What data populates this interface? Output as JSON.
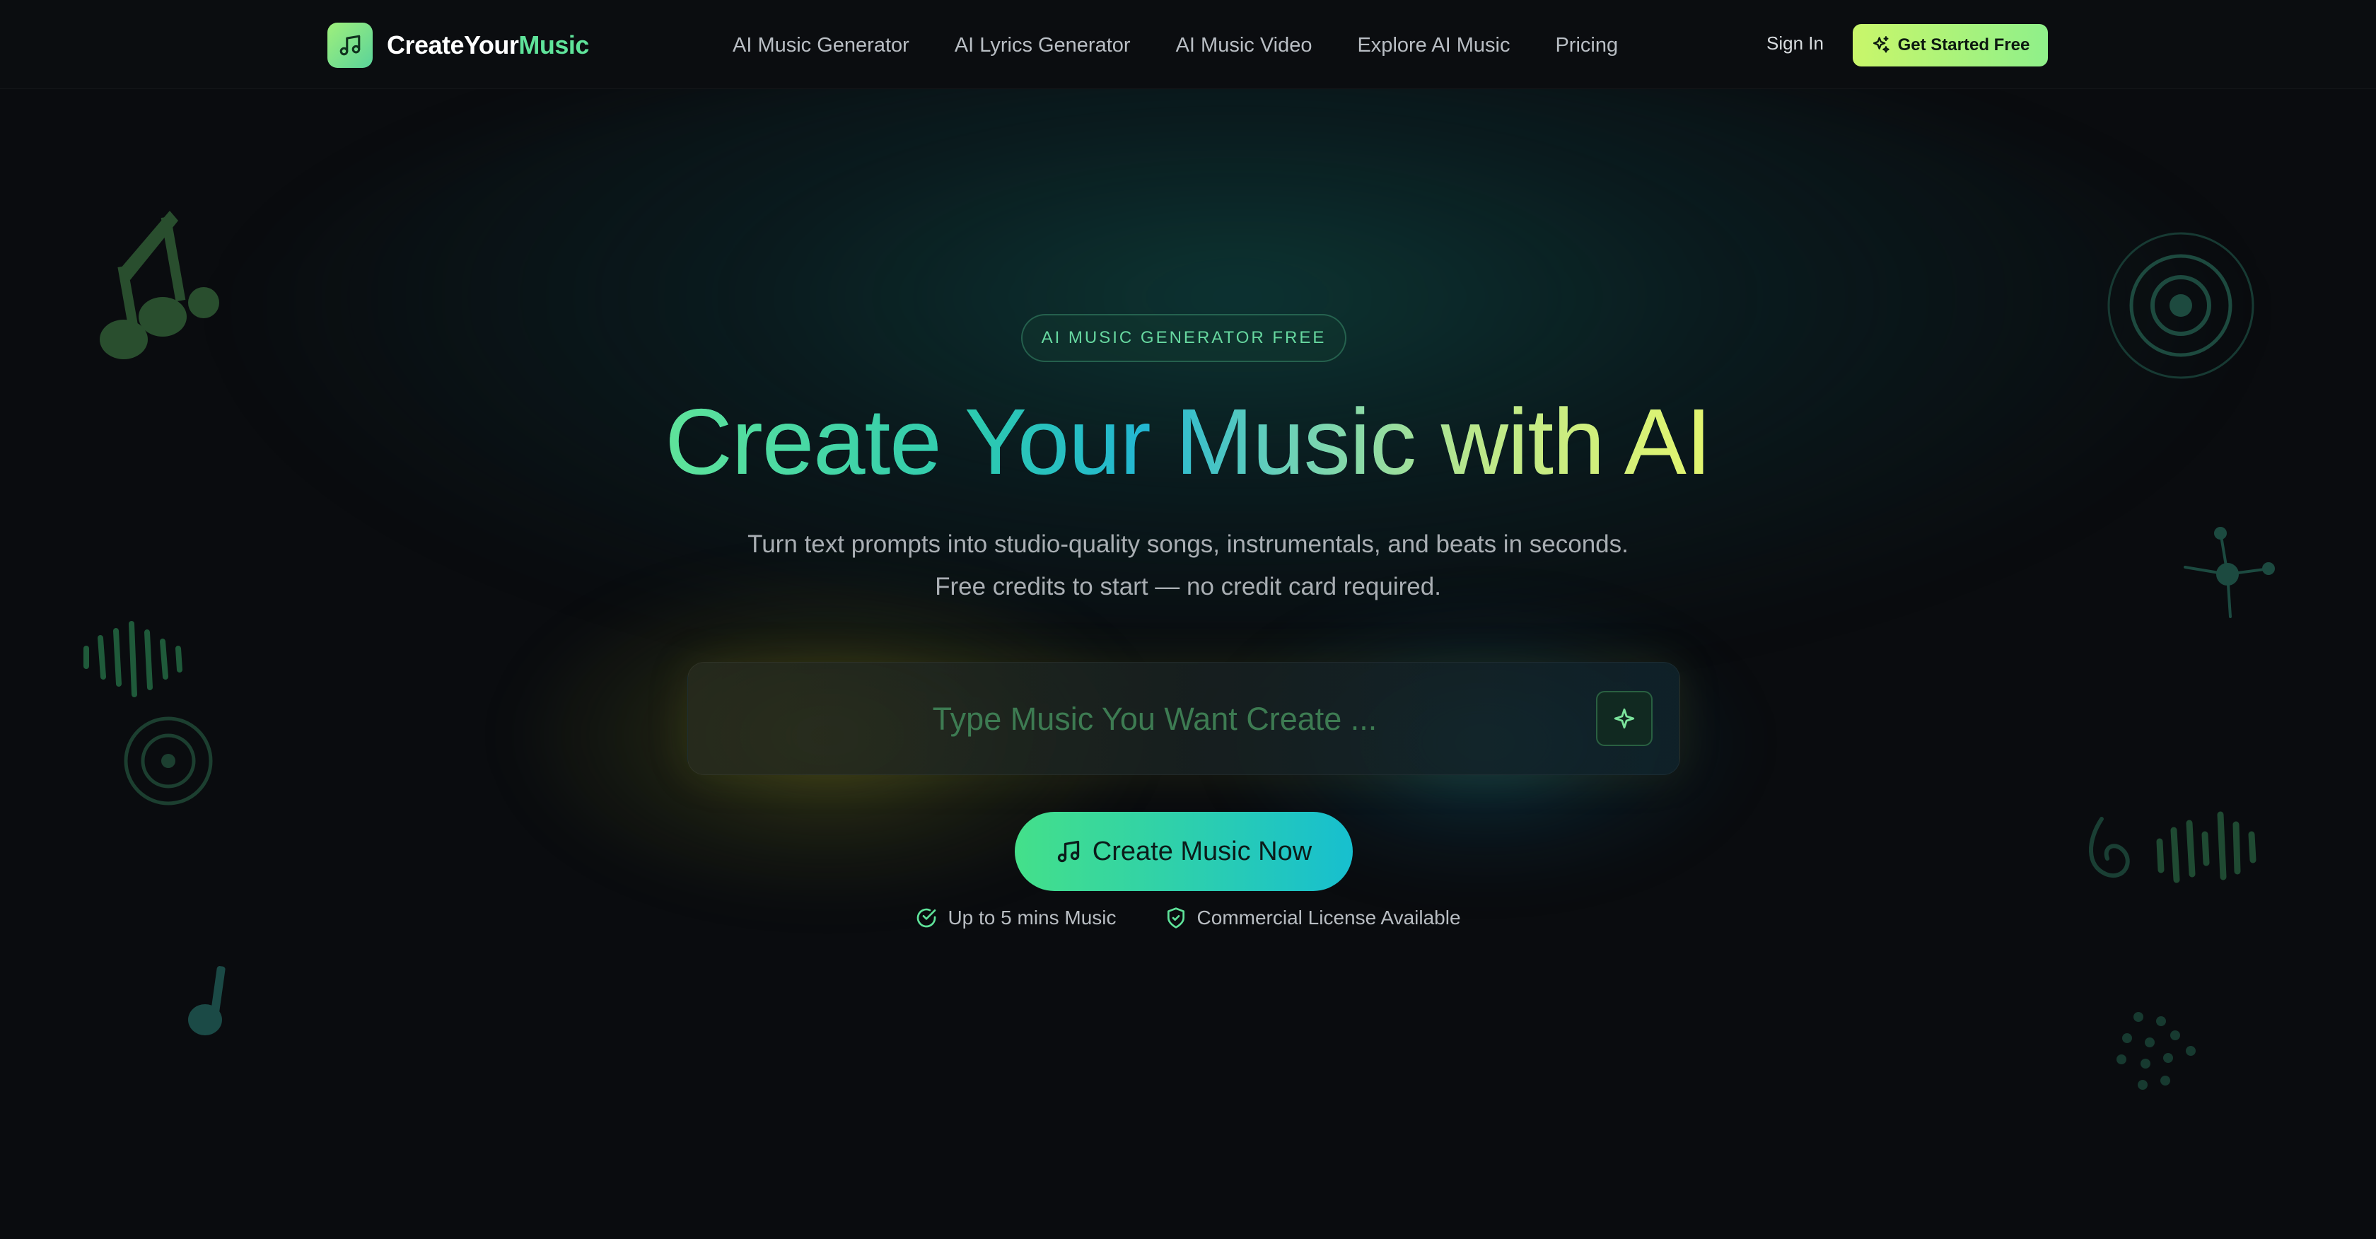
{
  "header": {
    "logo_word_1": "CreateYour",
    "logo_word_2": "Music",
    "nav": [
      "AI Music Generator",
      "AI Lyrics Generator",
      "AI Music Video",
      "Explore AI Music",
      "Pricing"
    ],
    "sign_in": "Sign In",
    "cta": "Get Started Free"
  },
  "hero": {
    "badge": "AI MUSIC GENERATOR FREE",
    "headline": "Create Your Music with AI",
    "subtitle_line_1": "Turn text prompts into studio-quality songs, instrumentals, and beats in seconds.",
    "subtitle_line_2": "Free credits to start — no credit card required.",
    "prompt": {
      "placeholder": "Type Music You Want Create ...",
      "value": ""
    },
    "create_button": "Create Music Now",
    "features": [
      {
        "icon": "check-circle-icon",
        "label": "Up to 5 mins Music"
      },
      {
        "icon": "shield-check-icon",
        "label": "Commercial License Available"
      }
    ]
  },
  "colors": {
    "accent_green": "#5fe39a",
    "accent_lime": "#c9f66a",
    "accent_cyan": "#17bfcf",
    "background": "#0a0c0f"
  }
}
